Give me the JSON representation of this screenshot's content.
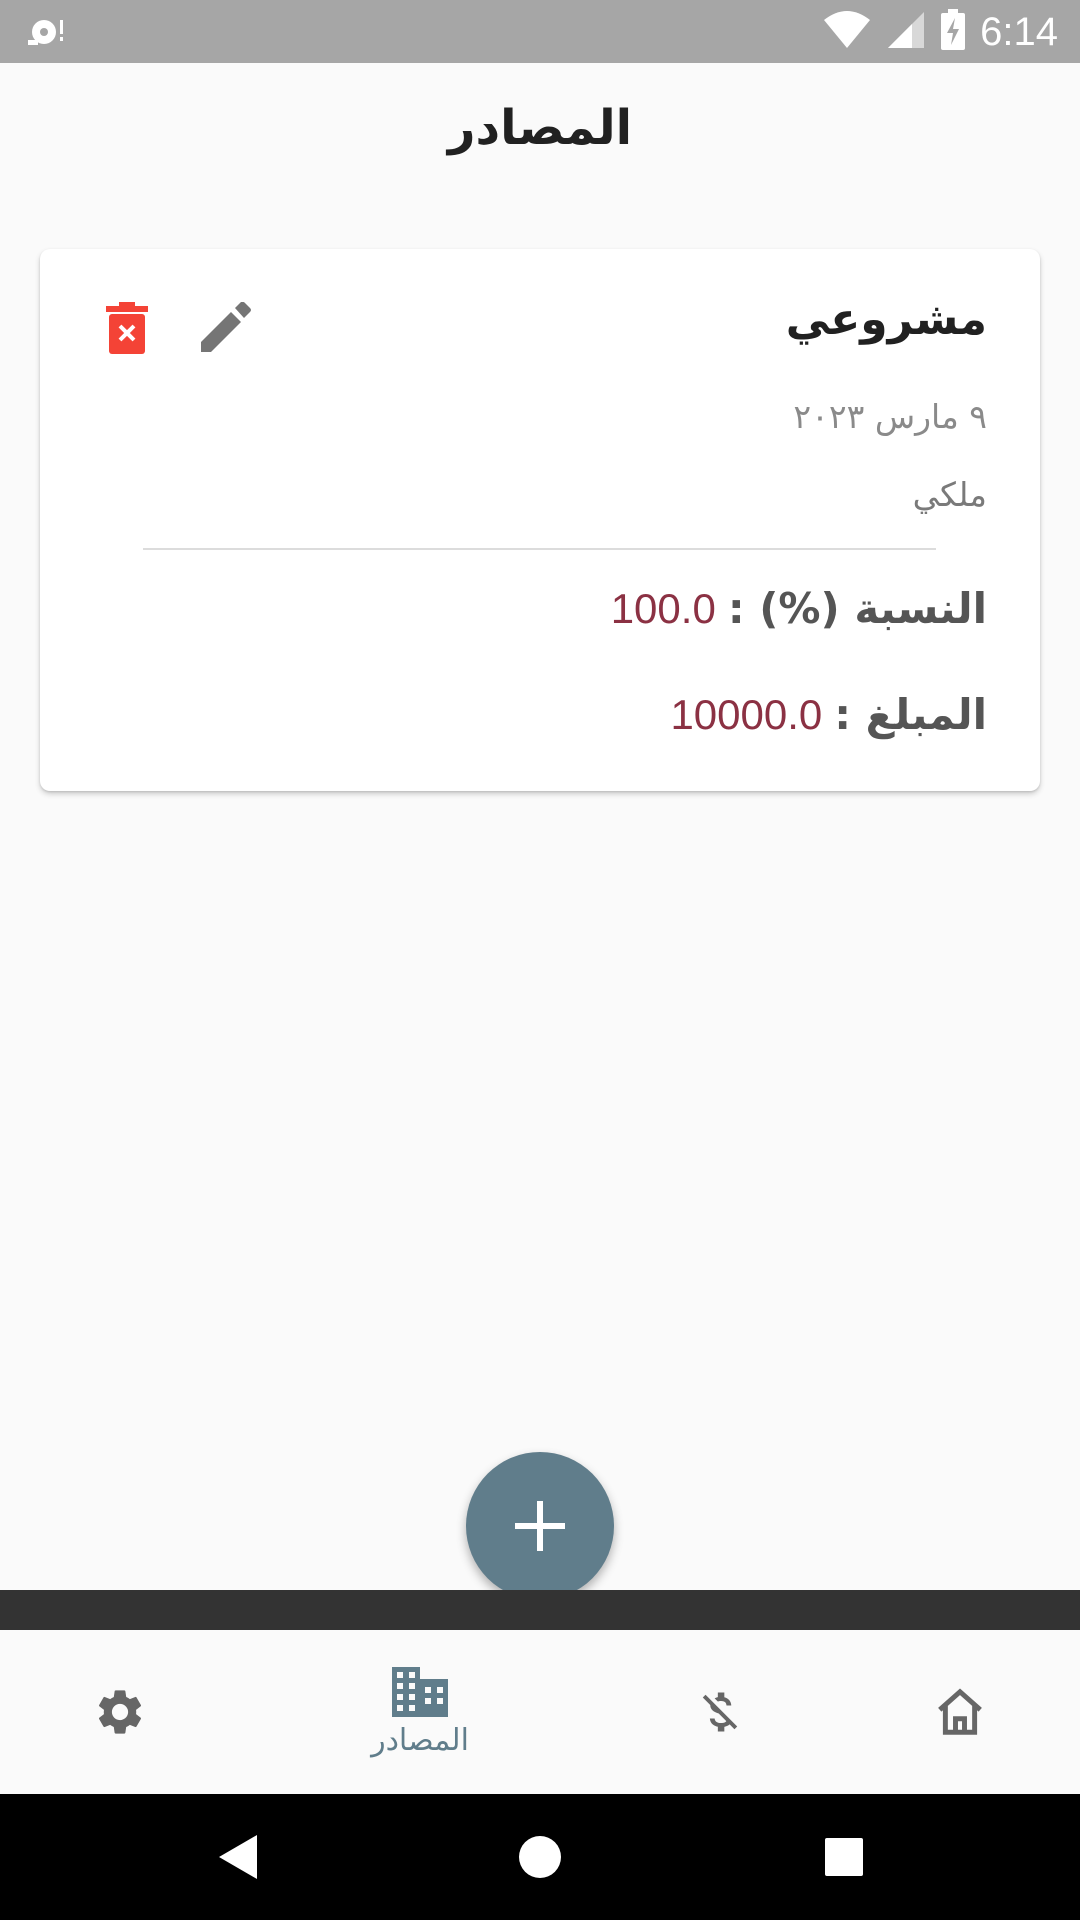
{
  "status_bar": {
    "time": "6:14",
    "icons": [
      "wifi-icon",
      "cell-signal-icon",
      "battery-charging-icon"
    ]
  },
  "header": {
    "title": "المصادر"
  },
  "card": {
    "name": "مشروعي",
    "date": "٩ مارس ٢٠٢٣",
    "type": "ملكي",
    "percent_label": "النسبة (%) :",
    "percent_value": "100.0",
    "amount_label": "المبلغ :",
    "amount_value": "10000.0",
    "delete_icon": "delete-icon",
    "edit_icon": "edit-icon"
  },
  "fab": {
    "icon": "plus-icon"
  },
  "bottom_nav": {
    "items": [
      {
        "icon": "gear-icon",
        "label": ""
      },
      {
        "icon": "building-icon",
        "label": "المصادر"
      },
      {
        "icon": "money-off-icon",
        "label": ""
      },
      {
        "icon": "home-icon",
        "label": ""
      }
    ],
    "active_color": "#607d8b"
  },
  "colors": {
    "accent": "#607d8b",
    "value": "#8b3143",
    "delete": "#f44336"
  }
}
